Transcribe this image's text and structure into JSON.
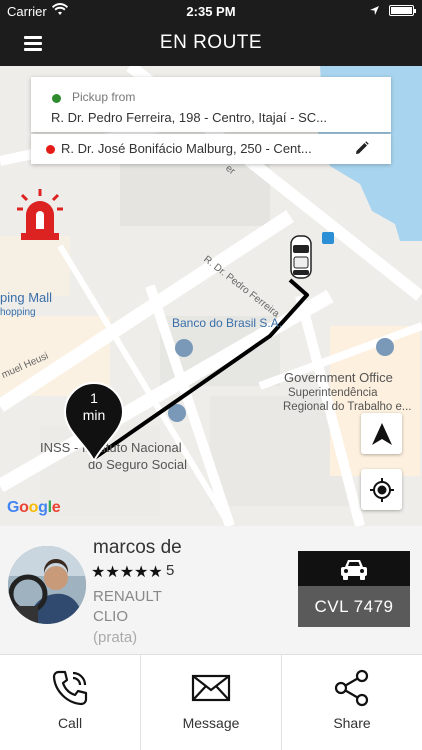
{
  "status_bar": {
    "carrier": "Carrier",
    "time": "2:35 PM"
  },
  "header": {
    "title": "EN ROUTE"
  },
  "trip": {
    "pickup_label": "Pickup from",
    "pickup_address": "R. Dr. Pedro Ferreira,  198 - Centro,  Itajaí - SC...",
    "destination_address": "R. Dr. José Bonifácio Malburg,  250 - Cent...",
    "pickup_dot_color": "#2e8b2e",
    "destination_dot_color": "#e41b17"
  },
  "map": {
    "eta_value": "1",
    "eta_unit": "min",
    "labels": {
      "mall": "ping Mall",
      "mall_sub": "hopping",
      "bank": "Banco do Brasil S.A.",
      "street_ferreira": "R. Dr. Pedro Ferreira",
      "street_heusi": "muel Heusi",
      "gov_office": "Government Office",
      "superintendencia": "Superintendência",
      "regional": "Regional do Trabalho e...",
      "inss": "INSS - Instituto Nacional",
      "seguro": "do Seguro Social",
      "er": "er"
    },
    "google_logo": "Google"
  },
  "driver": {
    "name": "marcos de",
    "stars": "★★★★★",
    "rating": "5",
    "car_make": "RENAULT",
    "car_model": "CLIO",
    "car_color": "(prata)",
    "plate": "CVL 7479"
  },
  "actions": [
    {
      "label": "Call",
      "icon": "phone-icon"
    },
    {
      "label": "Message",
      "icon": "envelope-icon"
    },
    {
      "label": "Share",
      "icon": "share-icon"
    }
  ]
}
